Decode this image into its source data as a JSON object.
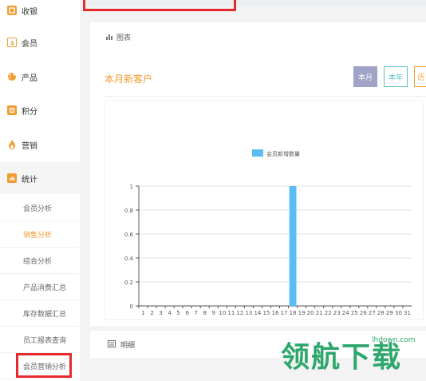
{
  "sidebar": {
    "items": [
      {
        "label": "收银",
        "icon": "cashier-icon",
        "color": "#f29b2f"
      },
      {
        "label": "会员",
        "icon": "member-card-icon",
        "color": "#f29b2f"
      },
      {
        "label": "产品",
        "icon": "palette-icon",
        "color": "#f29b2f"
      },
      {
        "label": "积分",
        "icon": "points-icon",
        "color": "#f29b2f"
      },
      {
        "label": "营销",
        "icon": "flame-icon",
        "color": "#f29b2f"
      },
      {
        "label": "统计",
        "icon": "stats-icon",
        "color": "#f29b2f"
      }
    ],
    "sub_items": [
      {
        "label": "会员分析"
      },
      {
        "label": "销售分析"
      },
      {
        "label": "综合分析"
      },
      {
        "label": "产品消费汇总"
      },
      {
        "label": "库存数据汇总"
      },
      {
        "label": "员工报表查询"
      },
      {
        "label": "会员营销分析"
      }
    ]
  },
  "panel": {
    "header": "图表",
    "chart_title": "本月新客户",
    "tabs": [
      {
        "label": "本月"
      },
      {
        "label": "本年"
      },
      {
        "label": "历"
      }
    ]
  },
  "detail": {
    "label": "明细"
  },
  "watermark": {
    "text": "领航下载",
    "url": "lhdown.com"
  },
  "colors": {
    "accent": "#f29b2f",
    "bar": "#5bbcf5",
    "highlight_box": "#e5292f"
  },
  "chart_data": {
    "type": "bar",
    "series": [
      {
        "name": "会员新增数量",
        "x": [
          1,
          2,
          3,
          4,
          5,
          6,
          7,
          8,
          9,
          10,
          11,
          12,
          13,
          14,
          15,
          16,
          17,
          18,
          19,
          20,
          21,
          22,
          23,
          24,
          25,
          26,
          27,
          28,
          29,
          30,
          31
        ],
        "values": [
          0,
          0,
          0,
          0,
          0,
          0,
          0,
          0,
          0,
          0,
          0,
          0,
          0,
          0,
          0,
          0,
          0,
          1,
          0,
          0,
          0,
          0,
          0,
          0,
          0,
          0,
          0,
          0,
          0,
          0,
          0
        ]
      }
    ],
    "categories": [
      "1",
      "2",
      "3",
      "4",
      "5",
      "6",
      "7",
      "8",
      "9",
      "10",
      "11",
      "12",
      "13",
      "14",
      "15",
      "16",
      "17",
      "18",
      "19",
      "20",
      "21",
      "22",
      "23",
      "24",
      "25",
      "26",
      "27",
      "28",
      "29",
      "30",
      "31"
    ],
    "yticks": [
      "0",
      "0.2",
      "0.4",
      "0.6",
      "0.8",
      "1"
    ],
    "ylim": [
      0,
      1
    ],
    "grid": true,
    "legend_position": "top-center"
  }
}
